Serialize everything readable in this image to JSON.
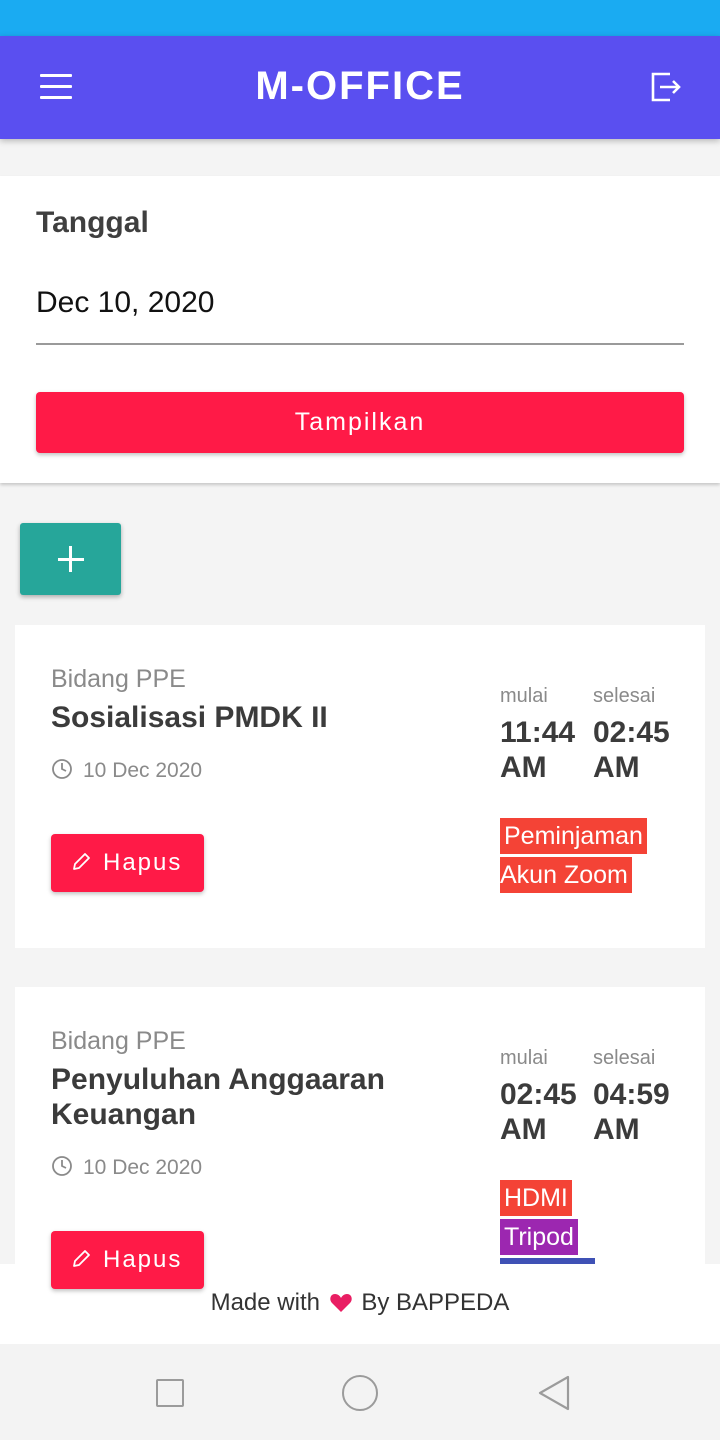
{
  "app": {
    "title": "M-OFFICE"
  },
  "filter": {
    "label": "Tanggal",
    "date_value": "Dec 10, 2020",
    "show_button": "Tampilkan"
  },
  "events": [
    {
      "department": "Bidang PPE",
      "title": "Sosialisasi PMDK II",
      "date": "10 Dec 2020",
      "start_label": "mulai",
      "end_label": "selesai",
      "start_time": "11:44",
      "start_ampm": "AM",
      "end_time": "02:45",
      "end_ampm": "AM",
      "tags": [
        "Peminjaman",
        "Akun Zoom"
      ],
      "delete_label": "Hapus"
    },
    {
      "department": "Bidang PPE",
      "title": "Penyuluhan Anggaaran Keuangan",
      "date": "10 Dec 2020",
      "start_label": "mulai",
      "end_label": "selesai",
      "start_time": "02:45",
      "start_ampm": "AM",
      "end_time": "04:59",
      "end_ampm": "AM",
      "tags": [
        "HDMI",
        "Tripod"
      ],
      "delete_label": "Hapus"
    }
  ],
  "footer": {
    "before": "Made with",
    "after": "By BAPPEDA"
  },
  "colors": {
    "status_bar": "#1aabf2",
    "app_bar": "#5a4ff0",
    "primary_button": "#ff1a47",
    "add_button": "#26a69a",
    "tag_red": "#f44336",
    "tag_purple": "#9c27b0",
    "heart": "#e91e63"
  }
}
